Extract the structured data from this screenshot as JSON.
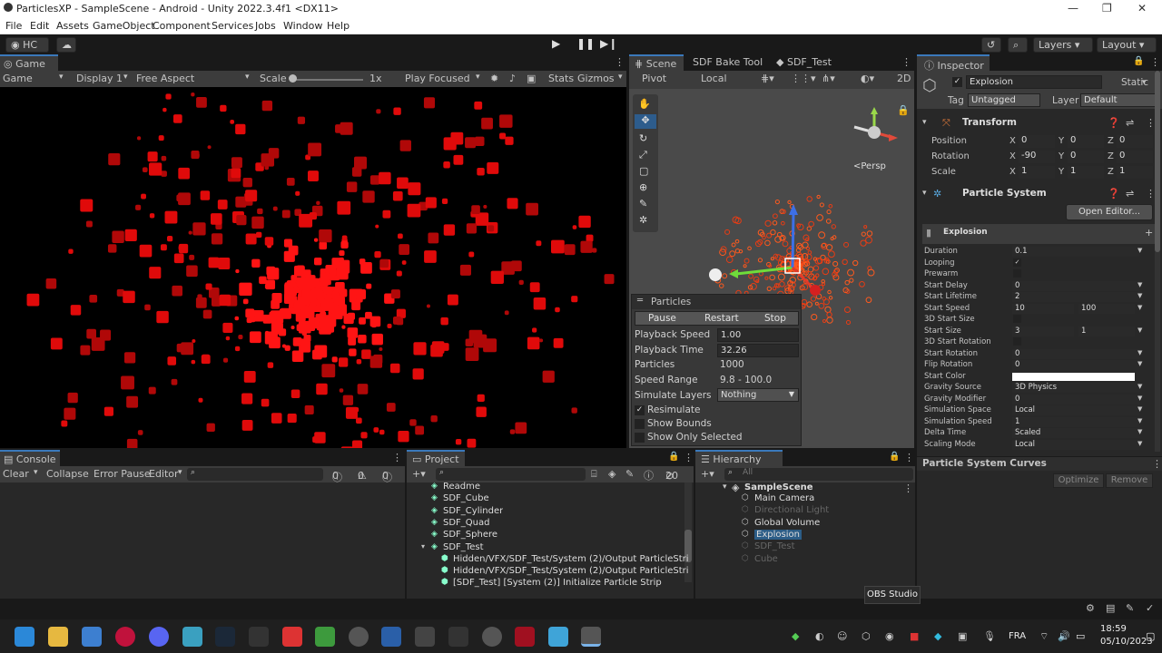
{
  "window": {
    "title": "ParticlesXP - SampleScene - Android - Unity 2022.3.4f1 <DX11>"
  },
  "menu": [
    "File",
    "Edit",
    "Assets",
    "GameObject",
    "Component",
    "Services",
    "Jobs",
    "Window",
    "Help"
  ],
  "toolbar": {
    "account": "HC",
    "layers": "Layers",
    "layout": "Layout"
  },
  "game": {
    "tab": "Game",
    "mode": "Game",
    "display": "Display 1",
    "aspect": "Free Aspect",
    "scale_label": "Scale",
    "scale_value": "1x",
    "play_focused": "Play Focused",
    "stats": "Stats",
    "gizmos": "Gizmos"
  },
  "scene": {
    "tabs": [
      "Scene",
      "SDF Bake Tool",
      "SDF_Test"
    ],
    "pivot": "Pivot",
    "local": "Local",
    "persp": "<Persp",
    "mode2d": "2D"
  },
  "particles_overlay": {
    "title": "Particles",
    "pause": "Pause",
    "restart": "Restart",
    "stop": "Stop",
    "rows": [
      {
        "label": "Playback Speed",
        "value": "1.00"
      },
      {
        "label": "Playback Time",
        "value": "32.26"
      },
      {
        "label": "Particles",
        "value": "1000"
      },
      {
        "label": "Speed Range",
        "value": "9.8 - 100.0"
      },
      {
        "label": "Simulate Layers",
        "value": "Nothing"
      }
    ],
    "checks": [
      {
        "label": "Resimulate",
        "checked": true
      },
      {
        "label": "Show Bounds",
        "checked": false
      },
      {
        "label": "Show Only Selected",
        "checked": false
      }
    ]
  },
  "inspector": {
    "tab": "Inspector",
    "object_name": "Explosion",
    "static": "Static",
    "tag_label": "Tag",
    "tag": "Untagged",
    "layer_label": "Layer",
    "layer": "Default",
    "transform": {
      "title": "Transform",
      "rows": [
        {
          "label": "Position",
          "x": "0",
          "y": "0",
          "z": "0"
        },
        {
          "label": "Rotation",
          "x": "-90",
          "y": "0",
          "z": "0"
        },
        {
          "label": "Scale",
          "x": "1",
          "y": "1",
          "z": "1"
        }
      ]
    },
    "ps": {
      "title": "Particle System",
      "open_editor": "Open Editor...",
      "module": "Explosion",
      "rows": [
        [
          "Duration",
          "0.1",
          ""
        ],
        [
          "Looping",
          "✓",
          ""
        ],
        [
          "Prewarm",
          "",
          ""
        ],
        [
          "Start Delay",
          "0",
          ""
        ],
        [
          "Start Lifetime",
          "2",
          ""
        ],
        [
          "Start Speed",
          "10",
          "100"
        ],
        [
          "3D Start Size",
          "",
          ""
        ],
        [
          "Start Size",
          "3",
          "1"
        ],
        [
          "3D Start Rotation",
          "",
          ""
        ],
        [
          "Start Rotation",
          "0",
          ""
        ],
        [
          "Flip Rotation",
          "0",
          ""
        ],
        [
          "Start Color",
          "",
          ""
        ],
        [
          "Gravity Source",
          "3D Physics",
          ""
        ],
        [
          "Gravity Modifier",
          "0",
          ""
        ],
        [
          "Simulation Space",
          "Local",
          ""
        ],
        [
          "Simulation Speed",
          "1",
          ""
        ],
        [
          "Delta Time",
          "Scaled",
          ""
        ],
        [
          "Scaling Mode",
          "Local",
          ""
        ]
      ]
    },
    "curves": "Particle System Curves",
    "optimize": "Optimize",
    "remove": "Remove"
  },
  "console": {
    "tab": "Console",
    "clear": "Clear",
    "collapse": "Collapse",
    "error_pause": "Error Pause",
    "editor": "Editor",
    "counts": [
      "0",
      "0",
      "0"
    ]
  },
  "project": {
    "tab": "Project",
    "count": "20",
    "items": [
      "Readme",
      "SDF_Cube",
      "SDF_Cylinder",
      "SDF_Quad",
      "SDF_Sphere",
      "SDF_Test",
      "Hidden/VFX/SDF_Test/System (2)/Output ParticleStri",
      "Hidden/VFX/SDF_Test/System (2)/Output ParticleStri",
      "[SDF_Test] [System (2)] Initialize Particle Strip"
    ]
  },
  "hierarchy": {
    "tab": "Hierarchy",
    "search": "All",
    "scene": "SampleScene",
    "items": [
      {
        "name": "Main Camera",
        "dim": false
      },
      {
        "name": "Directional Light",
        "dim": true
      },
      {
        "name": "Global Volume",
        "dim": false
      },
      {
        "name": "Explosion",
        "dim": false,
        "selected": true
      },
      {
        "name": "SDF_Test",
        "dim": true
      },
      {
        "name": "Cube",
        "dim": true
      }
    ]
  },
  "tooltip": "OBS Studio",
  "taskbar": {
    "lang": "FRA",
    "time": "18:59",
    "date": "05/10/2023"
  }
}
